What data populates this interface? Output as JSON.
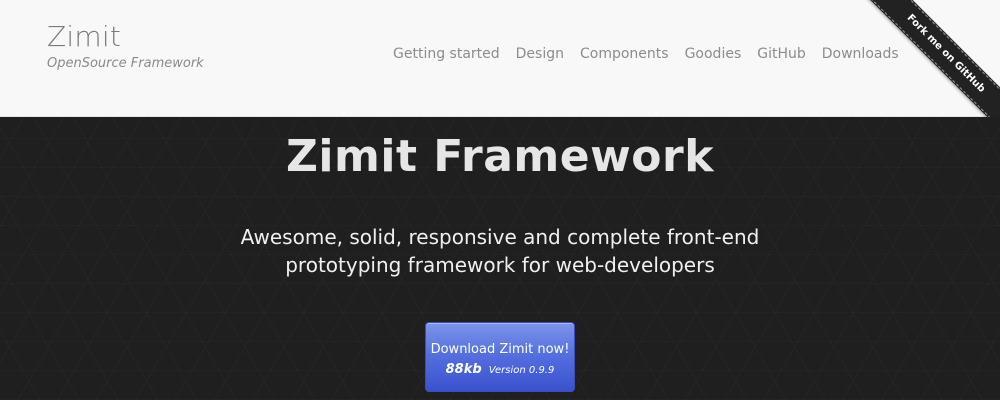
{
  "brand": {
    "title": "Zimit",
    "subtitle": "OpenSource Framework"
  },
  "nav": {
    "items": [
      {
        "label": "Getting started"
      },
      {
        "label": "Design"
      },
      {
        "label": "Components"
      },
      {
        "label": "Goodies"
      },
      {
        "label": "GitHub"
      },
      {
        "label": "Downloads"
      }
    ]
  },
  "ribbon": {
    "label": "Fork me on GitHub"
  },
  "hero": {
    "title": "Zimit Framework",
    "subtitle_line1": "Awesome, solid, responsive and complete front-end",
    "subtitle_line2": "prototyping framework for web-developers",
    "download": {
      "label": "Download Zimit now!",
      "size": "88kb",
      "version": "Version 0.9.9"
    }
  },
  "colors": {
    "header_bg": "#f8f8f8",
    "hero_bg": "#1f1f1f",
    "button_top": "#7d95ea",
    "button_bottom": "#3b51cf",
    "ribbon_bg": "#222222"
  }
}
